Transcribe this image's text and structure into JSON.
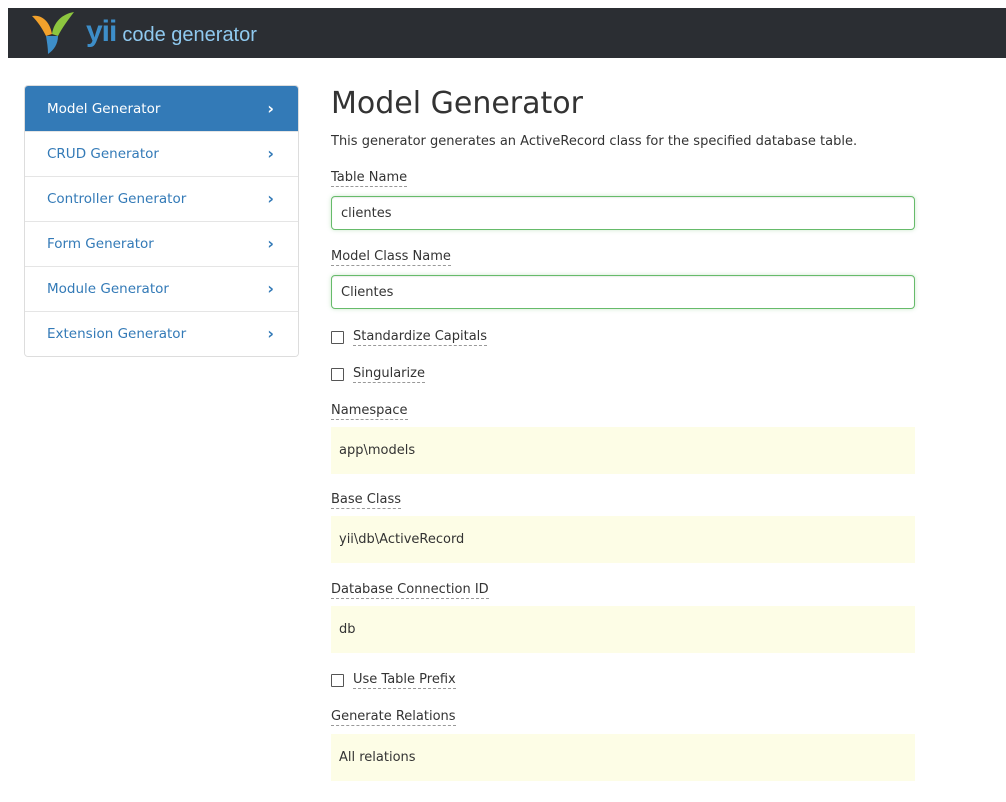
{
  "header": {
    "brand_yii": "yii",
    "brand_text": "code generator",
    "colors": {
      "bar": "#2b2e33",
      "yii": "#3d8ec9",
      "text": "#8fc9ef"
    }
  },
  "sidebar": {
    "items": [
      {
        "label": "Model Generator",
        "active": true
      },
      {
        "label": "CRUD Generator",
        "active": false
      },
      {
        "label": "Controller Generator",
        "active": false
      },
      {
        "label": "Form Generator",
        "active": false
      },
      {
        "label": "Module Generator",
        "active": false
      },
      {
        "label": "Extension Generator",
        "active": false
      }
    ],
    "chevron": "›"
  },
  "main": {
    "title": "Model Generator",
    "description": "This generator generates an ActiveRecord class for the specified database table.",
    "table_name": {
      "label": "Table Name",
      "value": "clientes"
    },
    "model_class": {
      "label": "Model Class Name",
      "value": "Clientes"
    },
    "standardize_capitals": {
      "label": "Standardize Capitals",
      "checked": false
    },
    "singularize": {
      "label": "Singularize",
      "checked": false
    },
    "namespace": {
      "label": "Namespace",
      "value": "app\\models"
    },
    "base_class": {
      "label": "Base Class",
      "value": "yii\\db\\ActiveRecord"
    },
    "db_connection": {
      "label": "Database Connection ID",
      "value": "db"
    },
    "use_table_prefix": {
      "label": "Use Table Prefix",
      "checked": false
    },
    "generate_relations": {
      "label": "Generate Relations",
      "value": "All relations"
    }
  },
  "colors": {
    "accent": "#337ab7",
    "sticky_bg": "#fdfde6",
    "input_ok_border": "#66bb6a"
  }
}
